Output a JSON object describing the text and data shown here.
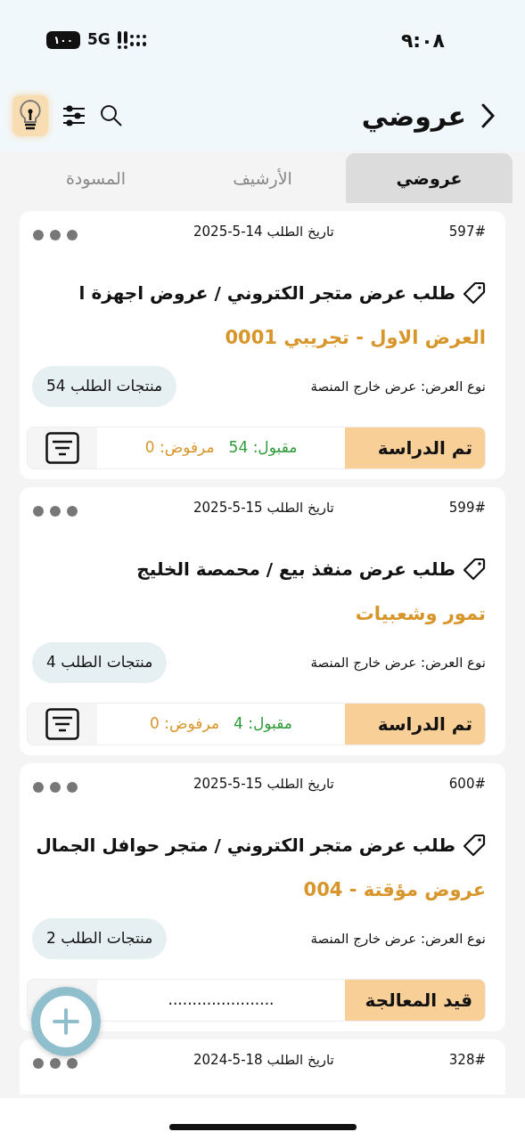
{
  "status_bar": {
    "time": "٩:٠٨",
    "network": "5G",
    "battery": "١٠٠"
  },
  "header": {
    "title": "عروضي"
  },
  "tabs": [
    {
      "label": "عروضي",
      "selected": true
    },
    {
      "label": "الأرشيف",
      "selected": false
    },
    {
      "label": "المسودة",
      "selected": false
    }
  ],
  "orders": [
    {
      "number": "597#",
      "date": "تاريخ الطلب 14-5-2025",
      "title": "طلب عرض متجر الكتروني / عروض اجهزة ا",
      "subtitle": "العرض الاول - تجريبي 0001",
      "offer_type": "نوع العرض: عرض خارج المنصة",
      "products": "منتجات الطلب 54",
      "status": "تم الدراسة",
      "kind": "counts",
      "accepted": "مقبول: 54",
      "rejected": "مرفوض: 0"
    },
    {
      "number": "599#",
      "date": "تاريخ الطلب 15-5-2025",
      "title": "طلب عرض منفذ بيع / محمصة الخليج",
      "subtitle": "تمور وشعبيات",
      "offer_type": "نوع العرض: عرض خارج المنصة",
      "products": "منتجات الطلب 4",
      "status": "تم الدراسة",
      "kind": "counts",
      "accepted": "مقبول: 4",
      "rejected": "مرفوض: 0"
    },
    {
      "number": "600#",
      "date": "تاريخ الطلب 15-5-2025",
      "title": "طلب عرض متجر الكتروني / متجر حوافل الجمال",
      "subtitle": "عروض مؤقتة - 004",
      "offer_type": "نوع العرض: عرض خارج المنصة",
      "products": "منتجات الطلب 2",
      "status": "قيد المعالجة",
      "kind": "pending",
      "placeholder_text": "......................"
    },
    {
      "number": "328#",
      "date": "تاريخ الطلب 18-5-2024",
      "kind": "partial"
    }
  ]
}
